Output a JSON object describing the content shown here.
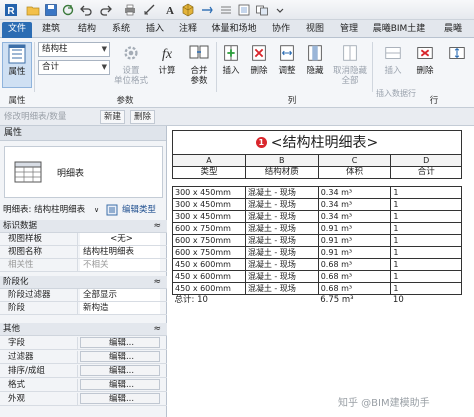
{
  "titlebar": {
    "icons": [
      "revit-app-icon",
      "open-icon",
      "save-icon",
      "sync-icon",
      "undo-icon",
      "redo-icon",
      "print-icon",
      "measure-icon",
      "text-icon",
      "3d-view-icon",
      "section-icon",
      "thin-lines-icon",
      "close-hidden-icon",
      "switch-windows-icon",
      "customize-icon"
    ]
  },
  "tabs": [
    "文件",
    "建筑",
    "结构",
    "系统",
    "插入",
    "注释",
    "体量和场地",
    "协作",
    "视图",
    "管理",
    "晨曦BIM土建",
    "晨曦"
  ],
  "ribbon": {
    "properties_btn": "属性",
    "field_combo": "结构柱",
    "calc_combo": "合计",
    "settings_btn": "设置",
    "unit_format_btn": "单位格式",
    "calculate_btn": "计算",
    "merge_btn": "合并",
    "merge_btn2": "参数",
    "insert_btn": "插入",
    "delete_btn": "删除",
    "resize_btn": "调整",
    "hide_btn": "隐藏",
    "unhide_btn": "取消隐藏",
    "unhide_btn2": "全部",
    "insert_row_btn": "插入",
    "insert_row_btn2": "插入数据行",
    "delete_row_btn": "删除",
    "group_labels": {
      "properties": "属性",
      "params": "参数",
      "columns": "列",
      "rows": "行"
    }
  },
  "optbar": {
    "hint": "修改明细表/数量",
    "new_btn": "新建",
    "delete_btn": "删除"
  },
  "properties": {
    "title": "属性",
    "type_name": "明细表",
    "type_selector": "明细表: 结构柱明细表",
    "edit_type": "编辑类型",
    "categories": [
      {
        "label": "标识数据",
        "toggle": "≈"
      },
      {
        "label": "阶段化",
        "toggle": "≈"
      },
      {
        "label": "其他",
        "toggle": "≈"
      }
    ],
    "identity_rows": [
      {
        "name": "视图样板",
        "value": "<无>"
      },
      {
        "name": "视图名称",
        "value": "结构柱明细表"
      },
      {
        "name": "相关性",
        "value": "不相关"
      }
    ],
    "phase_rows": [
      {
        "name": "阶段过滤器",
        "value": "全部显示"
      },
      {
        "name": "阶段",
        "value": "新构造"
      }
    ],
    "other_rows": [
      {
        "name": "字段",
        "value": "编辑..."
      },
      {
        "name": "过滤器",
        "value": "编辑..."
      },
      {
        "name": "排序/成组",
        "value": "编辑..."
      },
      {
        "name": "格式",
        "value": "编辑..."
      },
      {
        "name": "外观",
        "value": "编辑..."
      }
    ]
  },
  "schedule": {
    "badge": "1",
    "title": "<结构柱明细表>",
    "letters": [
      "A",
      "B",
      "C",
      "D"
    ],
    "headers": [
      "类型",
      "结构材质",
      "体积",
      "合计"
    ],
    "rows": [
      [
        "300 x 450mm",
        "混凝土 - 现场",
        "0.34 m³",
        "1"
      ],
      [
        "300 x 450mm",
        "混凝土 - 现场",
        "0.34 m³",
        "1"
      ],
      [
        "300 x 450mm",
        "混凝土 - 现场",
        "0.34 m³",
        "1"
      ],
      [
        "600 x 750mm",
        "混凝土 - 现场",
        "0.91 m³",
        "1"
      ],
      [
        "600 x 750mm",
        "混凝土 - 现场",
        "0.91 m³",
        "1"
      ],
      [
        "600 x 750mm",
        "混凝土 - 现场",
        "0.91 m³",
        "1"
      ],
      [
        "450 x 600mm",
        "混凝土 - 现场",
        "0.68 m³",
        "1"
      ],
      [
        "450 x 600mm",
        "混凝土 - 现场",
        "0.68 m³",
        "1"
      ],
      [
        "450 x 600mm",
        "混凝土 - 现场",
        "0.68 m³",
        "1"
      ]
    ],
    "total_label": "总计: 10",
    "total_volume": "6.75 m³",
    "total_count": "10"
  },
  "watermark": "知乎 @BIM建模助手"
}
